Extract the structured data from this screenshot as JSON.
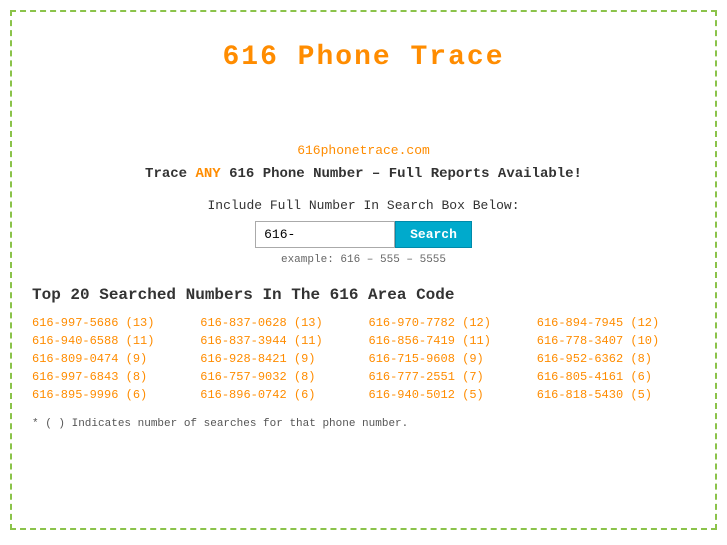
{
  "page": {
    "title": "616 Phone Trace",
    "site_url": "616phonetrace.com",
    "tagline_prefix": "Trace ",
    "tagline_any": "ANY",
    "tagline_suffix": " 616 Phone Number – Full Reports Available!",
    "search_label": "Include Full Number In Search Box Below:",
    "search_value": "616-",
    "search_placeholder": "616-",
    "search_button": "Search",
    "example": "example: 616 – 555 – 5555",
    "top_numbers_heading": "Top 20 Searched Numbers In The 616 Area Code",
    "footnote": "* ( ) Indicates number of searches for that phone number."
  },
  "phone_numbers": [
    {
      "number": "616-997-5686 (13)",
      "href": "#"
    },
    {
      "number": "616-837-0628 (13)",
      "href": "#"
    },
    {
      "number": "616-970-7782 (12)",
      "href": "#"
    },
    {
      "number": "616-894-7945 (12)",
      "href": "#"
    },
    {
      "number": "616-940-6588 (11)",
      "href": "#"
    },
    {
      "number": "616-837-3944 (11)",
      "href": "#"
    },
    {
      "number": "616-856-7419 (11)",
      "href": "#"
    },
    {
      "number": "616-778-3407 (10)",
      "href": "#"
    },
    {
      "number": "616-809-0474 (9)",
      "href": "#"
    },
    {
      "number": "616-928-8421 (9)",
      "href": "#"
    },
    {
      "number": "616-715-9608 (9)",
      "href": "#"
    },
    {
      "number": "616-952-6362 (8)",
      "href": "#"
    },
    {
      "number": "616-997-6843 (8)",
      "href": "#"
    },
    {
      "number": "616-757-9032 (8)",
      "href": "#"
    },
    {
      "number": "616-777-2551 (7)",
      "href": "#"
    },
    {
      "number": "616-805-4161 (6)",
      "href": "#"
    },
    {
      "number": "616-895-9996 (6)",
      "href": "#"
    },
    {
      "number": "616-896-0742 (6)",
      "href": "#"
    },
    {
      "number": "616-940-5012 (5)",
      "href": "#"
    },
    {
      "number": "616-818-5430 (5)",
      "href": "#"
    }
  ]
}
